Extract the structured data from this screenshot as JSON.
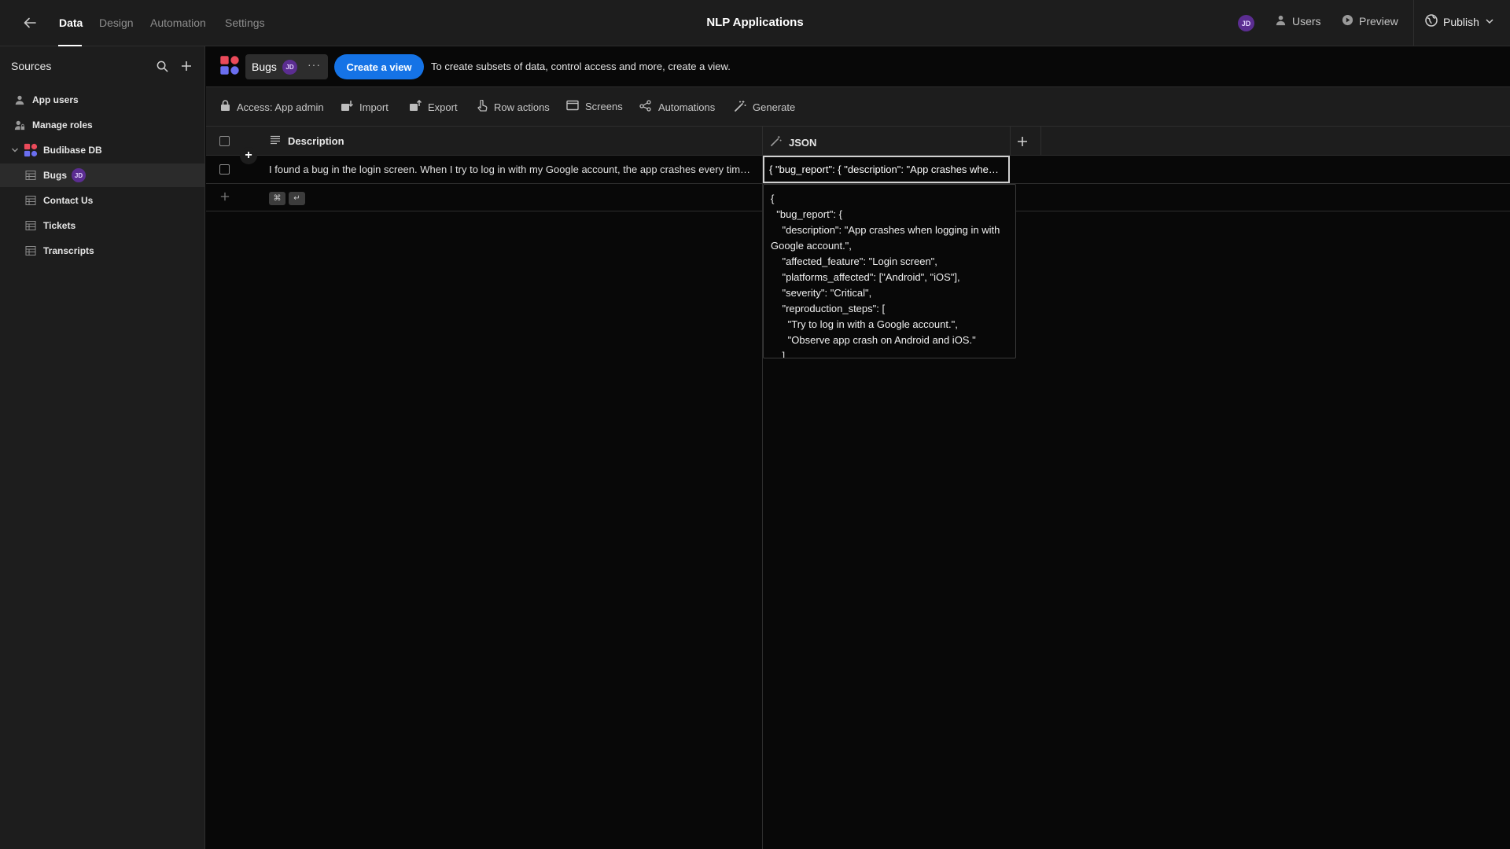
{
  "topbar": {
    "tabs": [
      {
        "label": "Data"
      },
      {
        "label": "Design"
      },
      {
        "label": "Automation"
      },
      {
        "label": "Settings"
      }
    ],
    "app_title": "NLP Applications",
    "user_initials": "JD",
    "users_label": "Users",
    "preview_label": "Preview",
    "publish_label": "Publish"
  },
  "sidebar": {
    "title": "Sources",
    "items": [
      {
        "label": "App users",
        "icon": "user-icon"
      },
      {
        "label": "Manage roles",
        "icon": "user-lock-icon"
      },
      {
        "label": "Budibase DB",
        "icon": "budibase-db-icon"
      },
      {
        "label": "Bugs",
        "icon": "table-icon",
        "badge": "JD"
      },
      {
        "label": "Contact Us",
        "icon": "table-icon"
      },
      {
        "label": "Tickets",
        "icon": "table-icon"
      },
      {
        "label": "Transcripts",
        "icon": "table-icon"
      }
    ]
  },
  "header": {
    "table_name": "Bugs",
    "table_badge": "JD",
    "more": "···",
    "create_view_label": "Create a view",
    "hint": "To create subsets of data, control access and more, create a view."
  },
  "toolbar": {
    "items": [
      {
        "label": "Access: App admin",
        "icon": "lock-icon"
      },
      {
        "label": "Import",
        "icon": "import-icon"
      },
      {
        "label": "Export",
        "icon": "export-icon"
      },
      {
        "label": "Row actions",
        "icon": "row-actions-icon"
      },
      {
        "label": "Screens",
        "icon": "screens-icon"
      },
      {
        "label": "Automations",
        "icon": "automations-icon"
      },
      {
        "label": "Generate",
        "icon": "magic-wand-icon"
      }
    ]
  },
  "grid": {
    "columns": [
      {
        "label": "Description",
        "icon": "text-icon"
      },
      {
        "label": "JSON",
        "icon": "magic-wand-icon"
      }
    ],
    "rows": [
      {
        "description": "I found a bug in the login screen. When I try to log in with my Google account, the app crashes every time. This happens on both Android and iOS.",
        "json": "{ \"bug_report\": { \"description\": \"App crashes when logging in with Google account.\", \"affected_feature\": \"Login screen\" } }"
      }
    ],
    "new_row_shortcut_keys": [
      "⌘",
      "↵"
    ]
  },
  "json_popover": {
    "content": "{\n  \"bug_report\": {\n    \"description\": \"App crashes when logging in with Google account.\",\n    \"affected_feature\": \"Login screen\",\n    \"platforms_affected\": [\"Android\", \"iOS\"],\n    \"severity\": \"Critical\",\n    \"reproduction_steps\": [\n      \"Try to log in with a Google account.\",\n      \"Observe app crash on Android and iOS.\"\n    ],"
  },
  "colors": {
    "accent": "#1573e6",
    "avatar": "#5b2d91",
    "background": "#080808",
    "panel": "#1d1d1d"
  }
}
